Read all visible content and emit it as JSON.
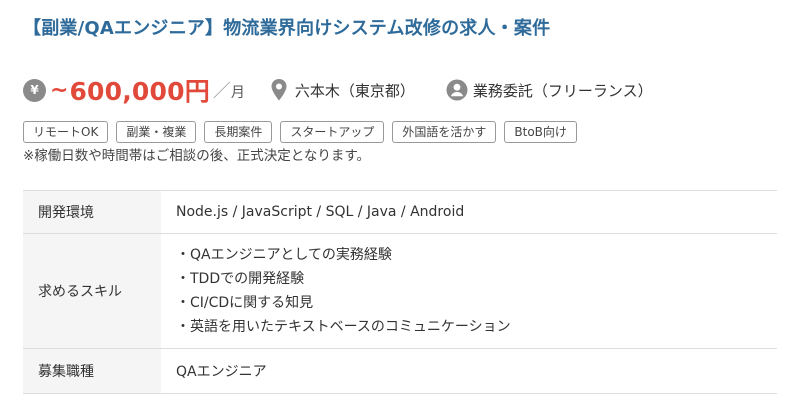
{
  "job": {
    "title": "【副業/QAエンジニア】物流業界向けシステム改修の求人・案件"
  },
  "meta": {
    "yen_symbol": "¥",
    "salary_prefix": "~",
    "salary_amount": "600,000円",
    "salary_slash": "／",
    "salary_unit": "月",
    "location": "六本木（東京都）",
    "contract": "業務委託（フリーランス）",
    "icons": {
      "salary": "yen-icon",
      "location": "map-pin-icon",
      "contract": "person-icon"
    },
    "colors": {
      "title": "#2f6b9a",
      "salary": "#e14a3b",
      "icon": "#8a8a8a"
    }
  },
  "tags": [
    "リモートOK",
    "副業・複業",
    "長期案件",
    "スタートアップ",
    "外国語を活かす",
    "BtoB向け"
  ],
  "note": "※稼働日数や時間帯はご相談の後、正式決定となります。",
  "details": {
    "environment": {
      "label": "開発環境",
      "value": "Node.js / JavaScript / SQL / Java / Android"
    },
    "skills": {
      "label": "求めるスキル",
      "items": [
        "QAエンジニアとしての実務経験",
        "TDDでの開発経験",
        "CI/CDに関する知見",
        "英語を用いたテキストベースのコミュニケーション"
      ]
    },
    "role": {
      "label": "募集職種",
      "value": "QAエンジニア"
    }
  }
}
